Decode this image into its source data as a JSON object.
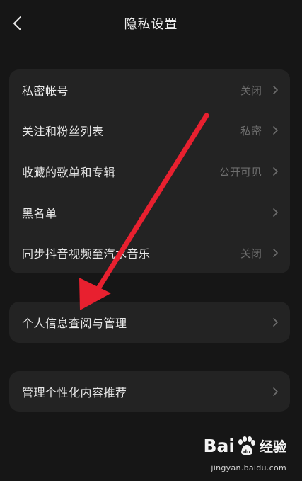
{
  "header": {
    "title": "隐私设置"
  },
  "group1": {
    "items": [
      {
        "label": "私密帐号",
        "value": "关闭"
      },
      {
        "label": "关注和粉丝列表",
        "value": "私密"
      },
      {
        "label": "收藏的歌单和专辑",
        "value": "公开可见"
      },
      {
        "label": "黑名单",
        "value": ""
      },
      {
        "label": "同步抖音视频至汽水音乐",
        "value": "关闭"
      }
    ]
  },
  "group2": {
    "label": "个人信息查阅与管理"
  },
  "group3": {
    "label": "管理个性化内容推荐"
  },
  "annotation": {
    "arrow_color": "#e8202f"
  },
  "watermark": {
    "brand_left": "Bai",
    "brand_right": "经验",
    "url": "jingyan.baidu.com"
  }
}
